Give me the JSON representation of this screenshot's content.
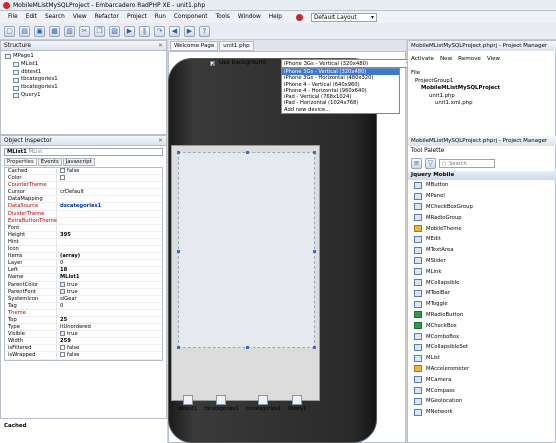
{
  "window": {
    "title": "MobileMListMySQLProject - Embarcadero RadPHP XE - unit1.php"
  },
  "menu": {
    "items": [
      "File",
      "Edit",
      "Search",
      "View",
      "Refactor",
      "Project",
      "Run",
      "Component",
      "Tools",
      "Window",
      "Help"
    ],
    "layout_value": "Default Layout"
  },
  "structure": {
    "title": "Structure",
    "items": [
      "MPage1",
      "MList1",
      "dbtest1",
      "tbcategories1",
      "tbcategories1",
      "Query1"
    ]
  },
  "inspector": {
    "title": "Object Inspector",
    "selected": "MList1",
    "selected_type": "MList",
    "tabs": [
      "Properties",
      "Events",
      "Javascript"
    ],
    "props": [
      {
        "k": "Cached",
        "v": "false",
        "cb": "unchecked"
      },
      {
        "k": "Color",
        "v": "",
        "cb": "unchecked"
      },
      {
        "k": "CounterTheme",
        "v": "",
        "red": true
      },
      {
        "k": "Cursor",
        "v": "crDefault"
      },
      {
        "k": "DataMapping",
        "v": ""
      },
      {
        "k": "DataSource",
        "v": "dscategories1",
        "red": true,
        "bold": true
      },
      {
        "k": "DividerTheme",
        "v": "",
        "red": true
      },
      {
        "k": "ExtraButtonTheme",
        "v": "",
        "red": true
      },
      {
        "k": "Font",
        "v": ""
      },
      {
        "k": "Height",
        "v": "395",
        "bold": true
      },
      {
        "k": "Hint",
        "v": ""
      },
      {
        "k": "Icon",
        "v": ""
      },
      {
        "k": "Items",
        "v": "(array)",
        "bold": true
      },
      {
        "k": "Layer",
        "v": "0"
      },
      {
        "k": "Left",
        "v": "18",
        "bold": true
      },
      {
        "k": "Name",
        "v": "MList1",
        "bold": true
      },
      {
        "k": "ParentColor",
        "v": "true",
        "cb": "checked"
      },
      {
        "k": "ParentFont",
        "v": "true",
        "cb": "checked"
      },
      {
        "k": "SystemIcon",
        "v": "siGear"
      },
      {
        "k": "Tag",
        "v": "0"
      },
      {
        "k": "Theme",
        "v": "",
        "red": true
      },
      {
        "k": "Top",
        "v": "25",
        "bold": true
      },
      {
        "k": "Type",
        "v": "ltUnordered"
      },
      {
        "k": "Visible",
        "v": "true",
        "cb": "checked"
      },
      {
        "k": "Width",
        "v": "259",
        "bold": true
      },
      {
        "k": "isFiltered",
        "v": "false",
        "cb": "unchecked"
      },
      {
        "k": "isWrapped",
        "v": "false",
        "cb": "unchecked"
      }
    ],
    "footer": "Cached"
  },
  "designer": {
    "tabs": [
      "Welcome Page",
      "unit1.php"
    ],
    "use_background_label": "Use background",
    "device_value": "iPhone 3Gs - Vertical (320x480)",
    "device_options": [
      "iPhone 3Gs - Vertical (320x480)",
      "iPhone 3Gs - Horizontal (480x320)",
      "iPhone 4 - Vertical (640x960)",
      "iPhone 4 - Horizontal (960x640)",
      "iPad - Vertical (768x1024)",
      "iPad - Horizontal (1024x768)",
      "Add new device..."
    ],
    "nonvisual": [
      "dbtest1",
      "tbcategories1",
      "dscategories1",
      "Query1"
    ]
  },
  "project": {
    "header": "MobileMListMySQLProject.phprj - Project Manager",
    "buttons": [
      "Activate",
      "New",
      "Remove",
      "View"
    ],
    "tree": [
      "File",
      "ProjectGroup1",
      "MobileMListMySQLProject",
      "unit1.php",
      "unit1.xml.php"
    ]
  },
  "palette": {
    "header": "MobileMListMySQLProject.phprj - Project Manager",
    "title": "Tool Palette",
    "search_placeholder": "Search",
    "category": "Jquery Mobile",
    "items": [
      "MButton",
      "MPanel",
      "MCheckBoxGroup",
      "MRadioGroup",
      "MobileTheme",
      "MEdit",
      "MTextArea",
      "MSlider",
      "MLink",
      "MCollapsible",
      "MToolBar",
      "MToggle",
      "MRadioButton",
      "MCheckBox",
      "MComboBox",
      "MCollapsibleSet",
      "MList",
      "MAccelerometer",
      "MCamera",
      "MCompass",
      "MGeolocation",
      "MNetwork"
    ]
  }
}
